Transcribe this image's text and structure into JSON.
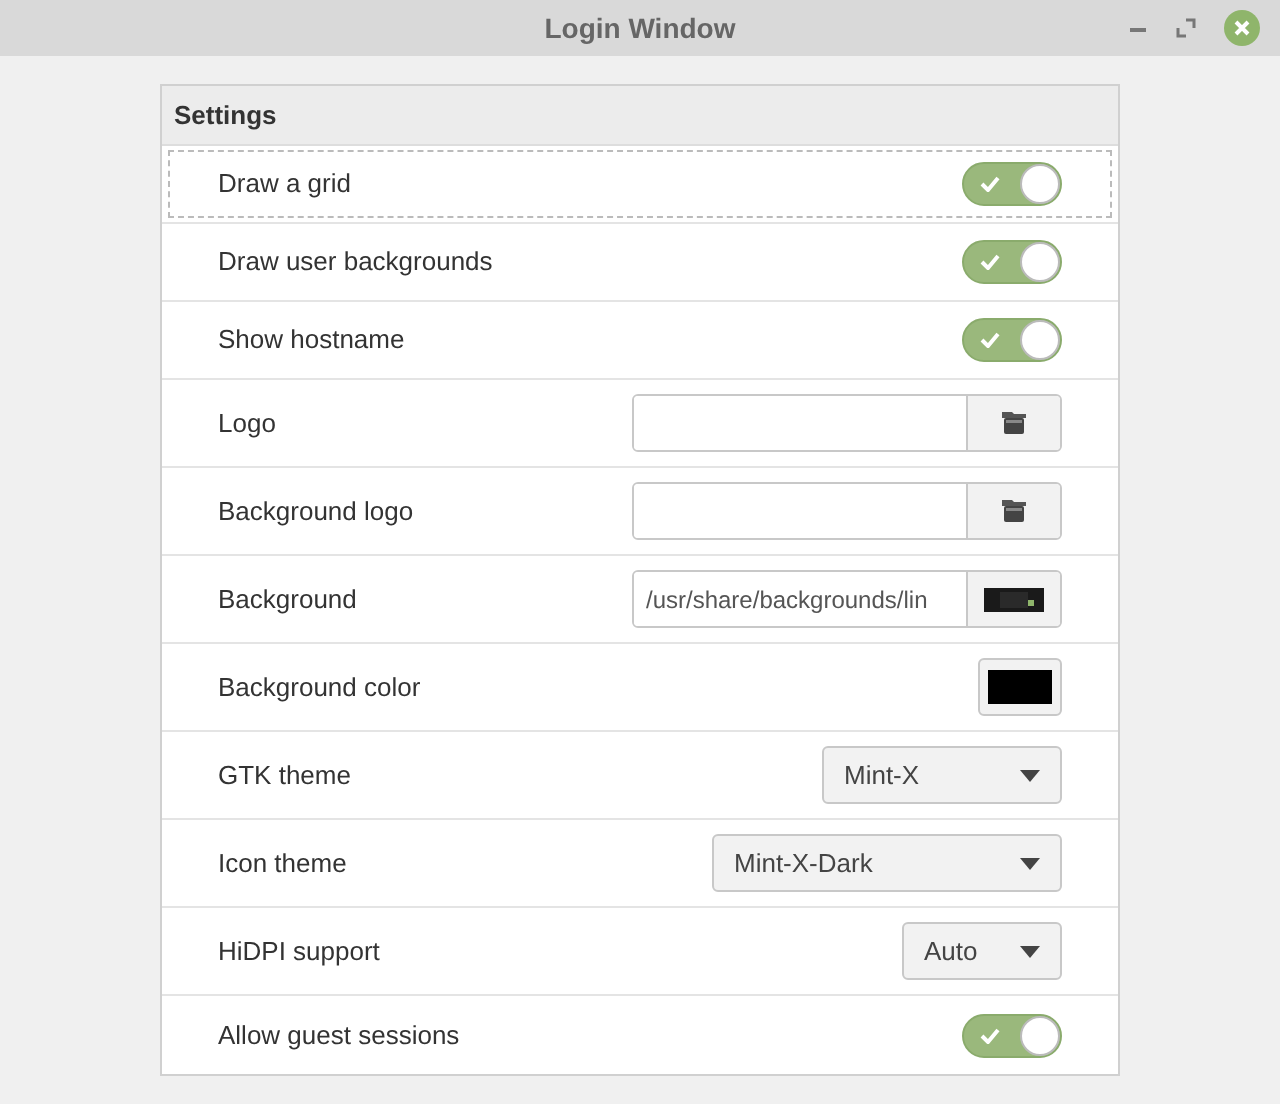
{
  "window": {
    "title": "Login Window"
  },
  "section": {
    "title": "Settings"
  },
  "rows": [
    {
      "kind": "switch",
      "label": "Draw a grid",
      "on": true,
      "focused": true
    },
    {
      "kind": "switch",
      "label": "Draw user backgrounds",
      "on": true,
      "focused": false
    },
    {
      "kind": "switch",
      "label": "Show hostname",
      "on": true,
      "focused": false
    },
    {
      "kind": "file",
      "label": "Logo",
      "focused": false
    },
    {
      "kind": "file",
      "label": "Background logo",
      "focused": false
    },
    {
      "label": "Background",
      "value": "/usr/share/backgrounds/lin",
      "focused": false
    },
    {
      "kind": "color",
      "label": "Background color",
      "color": "#000000",
      "focused": false
    },
    {
      "kind": "dropdown",
      "label": "GTK theme",
      "value": "Mint-X",
      "focused": false
    },
    {
      "kind": "dropdown",
      "label": "Icon theme",
      "value": "Mint-X-Dark",
      "focused": false
    },
    {
      "kind": "dropdown",
      "label": "HiDPI support",
      "value": "Auto",
      "focused": false
    },
    {
      "kind": "switch",
      "label": "Allow guest sessions",
      "on": true,
      "focused": false
    }
  ]
}
